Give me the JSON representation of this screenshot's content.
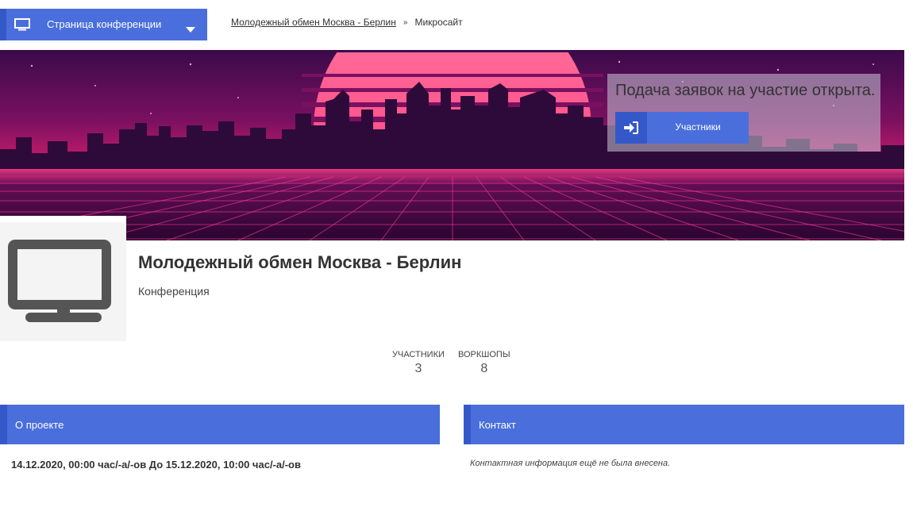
{
  "top_nav": {
    "dropdown_label": "Страница конференции",
    "dropdown_icon": "monitor-icon",
    "breadcrumb": {
      "link": "Молодежный обмен Москва - Берлин",
      "separator": "»",
      "current": "Микросайт"
    }
  },
  "banner": {
    "apply_text": "Подача заявок на участие открыта.",
    "participants_button": "Участники",
    "participants_icon": "sign-in-icon"
  },
  "event": {
    "title": "Молодежный обмен Москва - Берлин",
    "type": "Конференция"
  },
  "stats": [
    {
      "label": "УЧАСТНИКИ",
      "value": "3"
    },
    {
      "label": "ВОРКШОПЫ",
      "value": "8"
    }
  ],
  "about": {
    "header": "О проекте",
    "dates": "14.12.2020, 00:00 час/-а/-ов До 15.12.2020, 10:00 час/-а/-ов"
  },
  "contact": {
    "header": "Контакт",
    "text": "Контактная информация ещё не была внесена."
  },
  "colors": {
    "accent": "#4a6fdc",
    "accent_dark": "#3558c9"
  }
}
